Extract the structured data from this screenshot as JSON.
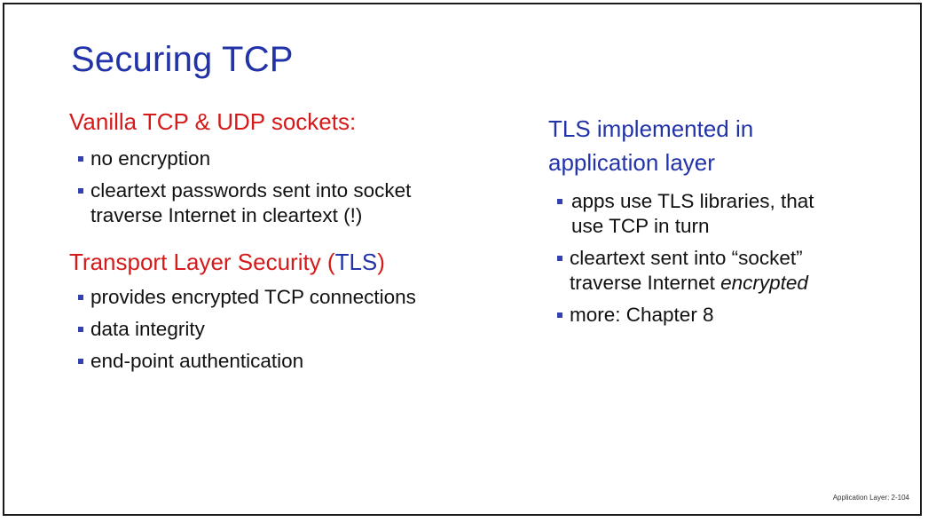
{
  "slide": {
    "title": "Securing TCP",
    "left": {
      "heading1": "Vanilla TCP & UDP sockets:",
      "items1": [
        {
          "text": "no encryption"
        },
        {
          "line1": "cleartext passwords sent into socket",
          "line2": "traverse Internet  in cleartext (!)"
        }
      ],
      "heading2_part1": "Transport Layer Security (",
      "heading2_tls": "TLS",
      "heading2_part2": ")",
      "items2": [
        {
          "text": "provides encrypted TCP connections"
        },
        {
          "text": "data integrity"
        },
        {
          "text": "end-point authentication"
        }
      ]
    },
    "right": {
      "heading_line1": "TLS implemented in",
      "heading_line2": "application layer",
      "items": [
        {
          "line1": "apps use TLS libraries, that",
          "line2": "use TCP in turn"
        },
        {
          "line1": "cleartext sent into “socket”",
          "line2_plain": "traverse Internet  ",
          "line2_em": "encrypted"
        },
        {
          "text": "more: Chapter 8"
        }
      ]
    },
    "footer": "Application Layer: 2-104"
  },
  "colors": {
    "title": "#2233aa",
    "heading_red": "#d41a1a",
    "bullet": "#3340b0"
  }
}
